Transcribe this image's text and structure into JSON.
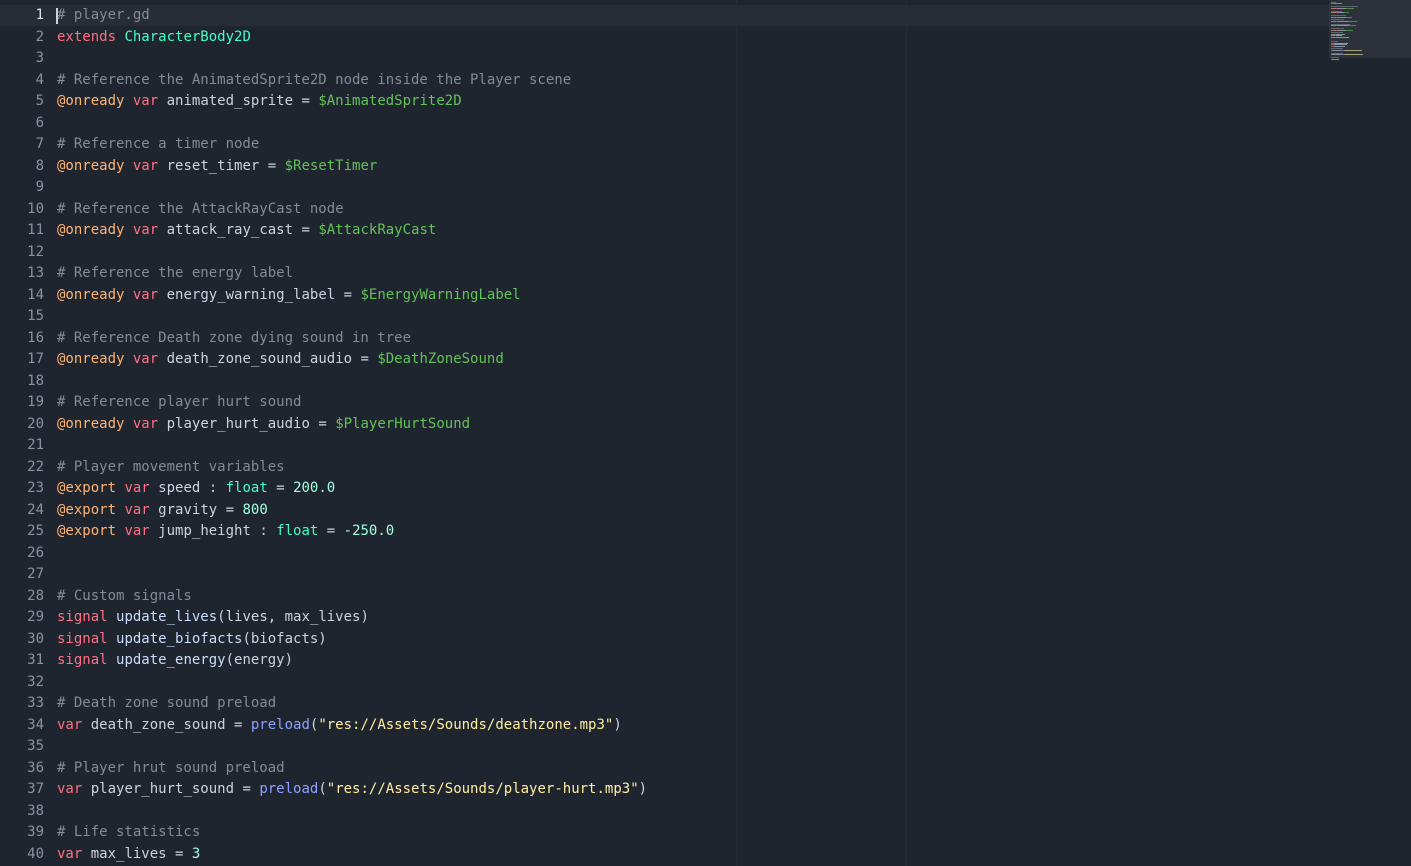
{
  "editor": {
    "file_name": "player.gd",
    "active_line": 1,
    "colors": {
      "background": "#1f252e",
      "current_line": "#262d37",
      "line_number": "#8b93a0",
      "comment": "#848b96",
      "keyword": "#ff7085",
      "annotation": "#ffb373",
      "class_name": "#42ffc2",
      "node_path": "#63c259",
      "number": "#a1ffe0",
      "string": "#ffeda1",
      "builtin_func": "#8fa1ff",
      "signal_name": "#c7dcff",
      "plain_text": "#cdd3de"
    },
    "lines": [
      {
        "n": "1",
        "tokens": [
          {
            "t": "# player.gd",
            "c": "comment"
          }
        ]
      },
      {
        "n": "2",
        "tokens": [
          {
            "t": "extends",
            "c": "keyword"
          },
          {
            "t": " ",
            "c": "plain"
          },
          {
            "t": "CharacterBody2D",
            "c": "class"
          }
        ]
      },
      {
        "n": "3",
        "tokens": []
      },
      {
        "n": "4",
        "tokens": [
          {
            "t": "# Reference the AnimatedSprite2D node inside the Player scene",
            "c": "comment"
          }
        ]
      },
      {
        "n": "5",
        "tokens": [
          {
            "t": "@onready",
            "c": "annotation"
          },
          {
            "t": " ",
            "c": "plain"
          },
          {
            "t": "var",
            "c": "keyword"
          },
          {
            "t": " animated_sprite = ",
            "c": "plain"
          },
          {
            "t": "$AnimatedSprite2D",
            "c": "node"
          }
        ]
      },
      {
        "n": "6",
        "tokens": []
      },
      {
        "n": "7",
        "tokens": [
          {
            "t": "# Reference a timer node",
            "c": "comment"
          }
        ]
      },
      {
        "n": "8",
        "tokens": [
          {
            "t": "@onready",
            "c": "annotation"
          },
          {
            "t": " ",
            "c": "plain"
          },
          {
            "t": "var",
            "c": "keyword"
          },
          {
            "t": " reset_timer = ",
            "c": "plain"
          },
          {
            "t": "$ResetTimer",
            "c": "node"
          }
        ]
      },
      {
        "n": "9",
        "tokens": []
      },
      {
        "n": "10",
        "tokens": [
          {
            "t": "# Reference the AttackRayCast node",
            "c": "comment"
          }
        ]
      },
      {
        "n": "11",
        "tokens": [
          {
            "t": "@onready",
            "c": "annotation"
          },
          {
            "t": " ",
            "c": "plain"
          },
          {
            "t": "var",
            "c": "keyword"
          },
          {
            "t": " attack_ray_cast = ",
            "c": "plain"
          },
          {
            "t": "$AttackRayCast",
            "c": "node"
          }
        ]
      },
      {
        "n": "12",
        "tokens": []
      },
      {
        "n": "13",
        "tokens": [
          {
            "t": "# Reference the energy label",
            "c": "comment"
          }
        ]
      },
      {
        "n": "14",
        "tokens": [
          {
            "t": "@onready",
            "c": "annotation"
          },
          {
            "t": " ",
            "c": "plain"
          },
          {
            "t": "var",
            "c": "keyword"
          },
          {
            "t": " energy_warning_label = ",
            "c": "plain"
          },
          {
            "t": "$EnergyWarningLabel",
            "c": "node"
          }
        ]
      },
      {
        "n": "15",
        "tokens": []
      },
      {
        "n": "16",
        "tokens": [
          {
            "t": "# Reference Death zone dying sound in tree",
            "c": "comment"
          }
        ]
      },
      {
        "n": "17",
        "tokens": [
          {
            "t": "@onready",
            "c": "annotation"
          },
          {
            "t": " ",
            "c": "plain"
          },
          {
            "t": "var",
            "c": "keyword"
          },
          {
            "t": " death_zone_sound_audio = ",
            "c": "plain"
          },
          {
            "t": "$DeathZoneSound",
            "c": "node"
          }
        ]
      },
      {
        "n": "18",
        "tokens": []
      },
      {
        "n": "19",
        "tokens": [
          {
            "t": "# Reference player hurt sound",
            "c": "comment"
          }
        ]
      },
      {
        "n": "20",
        "tokens": [
          {
            "t": "@onready",
            "c": "annotation"
          },
          {
            "t": " ",
            "c": "plain"
          },
          {
            "t": "var",
            "c": "keyword"
          },
          {
            "t": " player_hurt_audio = ",
            "c": "plain"
          },
          {
            "t": "$PlayerHurtSound",
            "c": "node"
          }
        ]
      },
      {
        "n": "21",
        "tokens": []
      },
      {
        "n": "22",
        "tokens": [
          {
            "t": "# Player movement variables",
            "c": "comment"
          }
        ]
      },
      {
        "n": "23",
        "tokens": [
          {
            "t": "@export",
            "c": "annotation"
          },
          {
            "t": " ",
            "c": "plain"
          },
          {
            "t": "var",
            "c": "keyword"
          },
          {
            "t": " speed : ",
            "c": "plain"
          },
          {
            "t": "float",
            "c": "class"
          },
          {
            "t": " = ",
            "c": "plain"
          },
          {
            "t": "200.0",
            "c": "number"
          }
        ]
      },
      {
        "n": "24",
        "tokens": [
          {
            "t": "@export",
            "c": "annotation"
          },
          {
            "t": " ",
            "c": "plain"
          },
          {
            "t": "var",
            "c": "keyword"
          },
          {
            "t": " gravity = ",
            "c": "plain"
          },
          {
            "t": "800",
            "c": "number"
          }
        ]
      },
      {
        "n": "25",
        "tokens": [
          {
            "t": "@export",
            "c": "annotation"
          },
          {
            "t": " ",
            "c": "plain"
          },
          {
            "t": "var",
            "c": "keyword"
          },
          {
            "t": " jump_height : ",
            "c": "plain"
          },
          {
            "t": "float",
            "c": "class"
          },
          {
            "t": " = ",
            "c": "plain"
          },
          {
            "t": "-250.0",
            "c": "number"
          }
        ]
      },
      {
        "n": "26",
        "tokens": []
      },
      {
        "n": "27",
        "tokens": []
      },
      {
        "n": "28",
        "tokens": [
          {
            "t": "# Custom signals",
            "c": "comment"
          }
        ]
      },
      {
        "n": "29",
        "tokens": [
          {
            "t": "signal",
            "c": "keyword"
          },
          {
            "t": " ",
            "c": "plain"
          },
          {
            "t": "update_lives",
            "c": "signal"
          },
          {
            "t": "(lives, max_lives)",
            "c": "plain"
          }
        ]
      },
      {
        "n": "30",
        "tokens": [
          {
            "t": "signal",
            "c": "keyword"
          },
          {
            "t": " ",
            "c": "plain"
          },
          {
            "t": "update_biofacts",
            "c": "signal"
          },
          {
            "t": "(biofacts)",
            "c": "plain"
          }
        ]
      },
      {
        "n": "31",
        "tokens": [
          {
            "t": "signal",
            "c": "keyword"
          },
          {
            "t": " ",
            "c": "plain"
          },
          {
            "t": "update_energy",
            "c": "signal"
          },
          {
            "t": "(energy)",
            "c": "plain"
          }
        ]
      },
      {
        "n": "32",
        "tokens": []
      },
      {
        "n": "33",
        "tokens": [
          {
            "t": "# Death zone sound preload",
            "c": "comment"
          }
        ]
      },
      {
        "n": "34",
        "tokens": [
          {
            "t": "var",
            "c": "keyword"
          },
          {
            "t": " death_zone_sound = ",
            "c": "plain"
          },
          {
            "t": "preload",
            "c": "builtin"
          },
          {
            "t": "(",
            "c": "plain"
          },
          {
            "t": "\"res://Assets/Sounds/deathzone.mp3\"",
            "c": "string"
          },
          {
            "t": ")",
            "c": "plain"
          }
        ]
      },
      {
        "n": "35",
        "tokens": []
      },
      {
        "n": "36",
        "tokens": [
          {
            "t": "# Player hrut sound preload",
            "c": "comment"
          }
        ]
      },
      {
        "n": "37",
        "tokens": [
          {
            "t": "var",
            "c": "keyword"
          },
          {
            "t": " player_hurt_sound = ",
            "c": "plain"
          },
          {
            "t": "preload",
            "c": "builtin"
          },
          {
            "t": "(",
            "c": "plain"
          },
          {
            "t": "\"res://Assets/Sounds/player-hurt.mp3\"",
            "c": "string"
          },
          {
            "t": ")",
            "c": "plain"
          }
        ]
      },
      {
        "n": "38",
        "tokens": []
      },
      {
        "n": "39",
        "tokens": [
          {
            "t": "# Life statistics",
            "c": "comment"
          }
        ]
      },
      {
        "n": "40",
        "tokens": [
          {
            "t": "var",
            "c": "keyword"
          },
          {
            "t": " max_lives = ",
            "c": "plain"
          },
          {
            "t": "3",
            "c": "number"
          }
        ]
      }
    ]
  }
}
